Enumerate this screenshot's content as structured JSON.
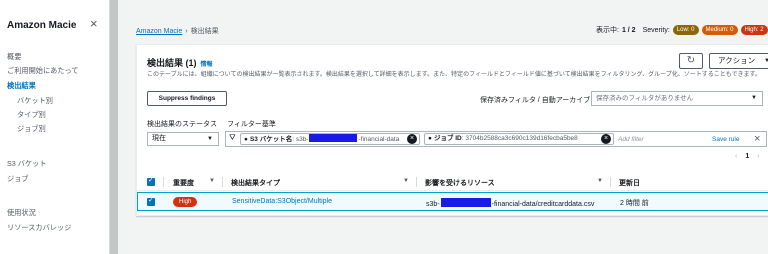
{
  "sidebar": {
    "title": "Amazon Macie",
    "items": [
      {
        "label": "概要"
      },
      {
        "label": "ご利用開始にあたって"
      },
      {
        "label": "検出結果"
      },
      {
        "label": "バケット別"
      },
      {
        "label": "タイプ別"
      },
      {
        "label": "ジョブ別"
      },
      {
        "label": "S3 バケット"
      },
      {
        "label": "ジョブ"
      },
      {
        "label": "使用状況"
      },
      {
        "label": "リソースカバレッジ"
      }
    ]
  },
  "breadcrumb": {
    "root": "Amazon Macie",
    "current": "検出結果"
  },
  "status": {
    "display_label": "表示中:",
    "display_value": "1 / 2",
    "severity_label": "Severity:",
    "low": "Low: 0",
    "medium": "Medium: 0",
    "high": "High: 2"
  },
  "panel": {
    "title": "検出結果 (1)",
    "info": "情報",
    "description": "このテーブルには、組織についての検出結果が一覧表示されます。検出結果を選択して詳細を表示します。また、特定のフィールドとフィールド値に基づいて検出結果をフィルタリング、グループ化、ソートすることもできます。",
    "actions_label": "アクション",
    "suppress_label": "Suppress findings",
    "saved_filter_label": "保存済みフィルタ / 自動アーカイブ",
    "saved_filter_placeholder": "保存済みのフィルタがありません",
    "status_label": "検出結果のステータス",
    "filter_label": "フィルター基準",
    "status_value": "現在",
    "token1_key": "S3 バケット名",
    "token1_prefix": "s3b-",
    "token1_suffix": "-financial-data",
    "token2_key": "ジョブ ID",
    "token2_value": "3704b2588ca3c690c139d16fecba5be8",
    "add_filter": "Add filter",
    "save_rule": "Save rule",
    "page_current": "1"
  },
  "table": {
    "columns": [
      "重要度",
      "検出結果タイプ",
      "影響を受けるリソース",
      "更新日"
    ],
    "rows": [
      {
        "severity": "High",
        "type": "SensitiveData:S3Object/Multiple",
        "resource_prefix": "s3b-",
        "resource_suffix": "-financial-data/creditcarddata.csv",
        "updated": "2 時間 前"
      }
    ]
  }
}
